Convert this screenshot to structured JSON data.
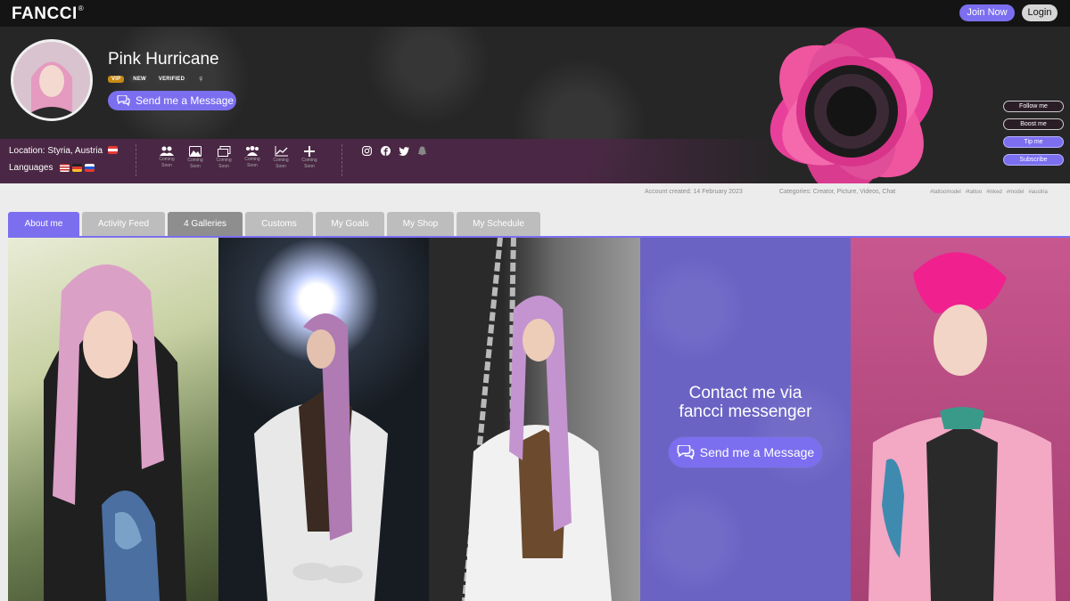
{
  "nav": {
    "logo": "FANCCI",
    "logo_mark": "®",
    "join_label": "Join Now",
    "login_label": "Login"
  },
  "profile": {
    "name": "Pink Hurricane",
    "badges": [
      "VIP",
      "NEW",
      "VERIFIED"
    ],
    "gender_icon": "venus-icon",
    "message_label": "Send me a Message",
    "location_label": "Location: Styria, Austria",
    "languages_label": "Languages"
  },
  "tools": {
    "coming_soon_line1": "Coming",
    "coming_soon_line2": "Soon",
    "icons": [
      "users-icon",
      "picture-icon",
      "gallery-icon",
      "group-icon",
      "chart-icon",
      "plus-icon"
    ]
  },
  "socials": [
    "instagram-icon",
    "facebook-icon",
    "twitter-icon",
    "snapchat-icon",
    "tiktok-icon",
    "youtube-icon",
    "twitch-icon",
    "vimeo-icon"
  ],
  "side_buttons": {
    "follow": "Follow me",
    "boost": "Boost me",
    "tip": "Tip me",
    "subscribe": "Subscribe"
  },
  "info": {
    "created": "Account created: 14 February 2023",
    "categories": "Categories: Creator, Picture, Videos, Chat",
    "tags": [
      "#tattoomodel",
      "#tattoo",
      "#inked",
      "#model",
      "#austria"
    ]
  },
  "tabs": [
    "About me",
    "Activity Feed",
    "4 Galleries",
    "Customs",
    "My Goals",
    "My Shop",
    "My Schedule"
  ],
  "contact": {
    "line1": "Contact me via",
    "line2": "fancci messenger",
    "button": "Send me a Message"
  },
  "colors": {
    "accent": "#7b6ff0",
    "banner_strip": "#4a2744",
    "contact_bg": "#6a63c4",
    "vip": "#c68a14"
  }
}
